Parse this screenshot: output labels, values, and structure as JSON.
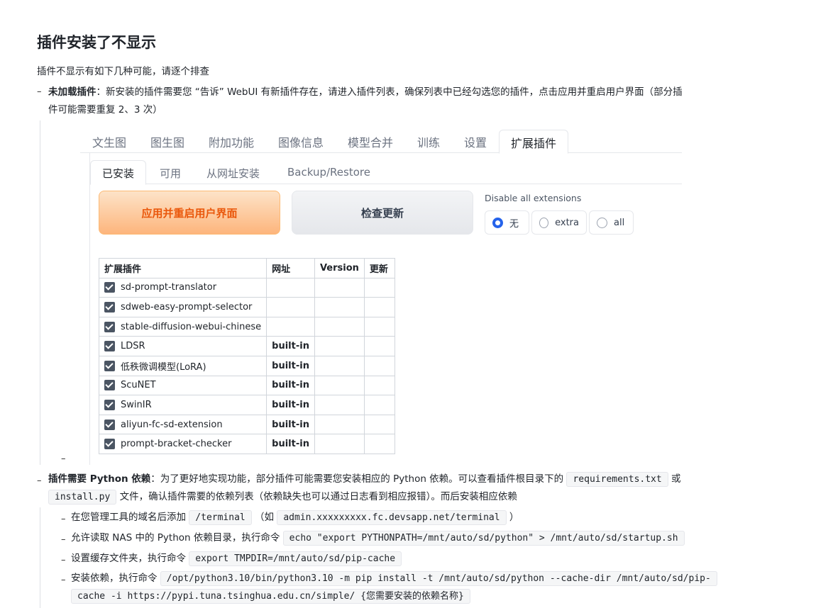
{
  "doc": {
    "title": "插件安装了不显示",
    "intro": "插件不显示有如下几种可能，请逐个排查",
    "item1_bold": "未加载插件",
    "item1_text_line1": "：新安装的插件需要您 “告诉” WebUI 有新插件存在，请进入插件列表，确保列表中已经勾选您的插件，点击应用并重启用户界面（部分插",
    "item1_text_line2": "件可能需要重复 2、3 次）",
    "item2_bold": "插件需要 Python 依赖",
    "item2_text1": "：为了更好地实现功能，部分插件可能需要您安装相应的 Python 依赖。可以查看插件根目录下的",
    "item2_code1": "requirements.txt",
    "item2_text2": "或",
    "item2_code2": "install.py",
    "item2_text3": "文件，确认插件需要的依赖列表（依赖缺失也可以通过日志看到相应报错）。而后安装相应依赖",
    "sub1_text": "在您管理工具的域名后添加",
    "sub1_code": "/terminal",
    "sub1_paren_open": "（如",
    "sub1_code2": "admin.xxxxxxxxx.fc.devsapp.net/terminal",
    "sub1_paren_close": "）",
    "sub2_text": "允许读取 NAS 中的 Python 依赖目录，执行命令",
    "sub2_code": "echo \"export PYTHONPATH=/mnt/auto/sd/python\" > /mnt/auto/sd/startup.sh",
    "sub3_text": "设置缓存文件夹，执行命令",
    "sub3_code": "export TMPDIR=/mnt/auto/sd/pip-cache",
    "sub4_text": "安装依赖，执行命令",
    "sub4_code_line1": "/opt/python3.10/bin/python3.10 -m pip install -t /mnt/auto/sd/python --cache-dir /mnt/auto/sd/pip-",
    "sub4_code_line2": "cache -i https://pypi.tuna.tsinghua.edu.cn/simple/ {您需要安装的依赖名称}",
    "dash": "–"
  },
  "webui": {
    "top_tabs": [
      "文生图",
      "图生图",
      "附加功能",
      "图像信息",
      "模型合并",
      "训练",
      "设置",
      "扩展插件"
    ],
    "sub_tabs": [
      "已安装",
      "可用",
      "从网址安装",
      "Backup/Restore"
    ],
    "apply_button": "应用并重启用户界面",
    "check_button": "检查更新",
    "disable_label": "Disable all extensions",
    "radio_options": [
      "无",
      "extra",
      "all"
    ],
    "radio_selected": "无",
    "table_headers": [
      "扩展插件",
      "网址",
      "Version",
      "更新"
    ],
    "extensions": [
      {
        "name": "sd-prompt-translator",
        "url": "",
        "checked": true
      },
      {
        "name": "sdweb-easy-prompt-selector",
        "url": "",
        "checked": true
      },
      {
        "name": "stable-diffusion-webui-chinese",
        "url": "",
        "checked": true
      },
      {
        "name": "LDSR",
        "url": "built-in",
        "checked": true
      },
      {
        "name": "低秩微调模型(LoRA)",
        "url": "built-in",
        "checked": true
      },
      {
        "name": "ScuNET",
        "url": "built-in",
        "checked": true
      },
      {
        "name": "SwinIR",
        "url": "built-in",
        "checked": true
      },
      {
        "name": "aliyun-fc-sd-extension",
        "url": "built-in",
        "checked": true
      },
      {
        "name": "prompt-bracket-checker",
        "url": "built-in",
        "checked": true
      }
    ]
  }
}
